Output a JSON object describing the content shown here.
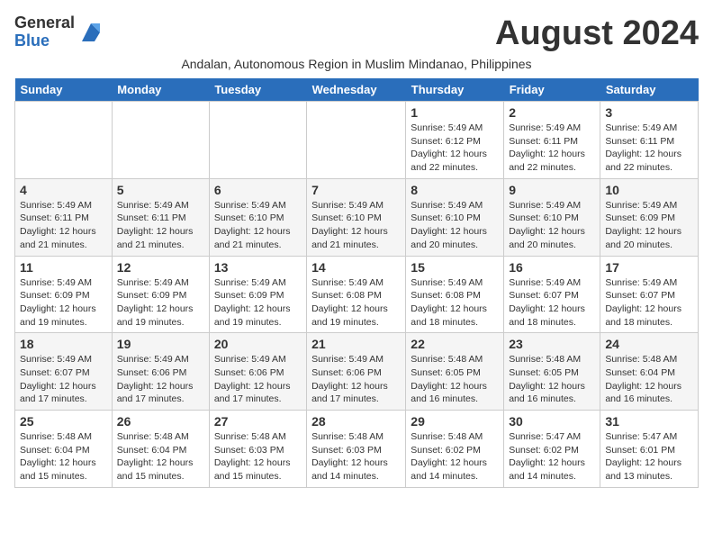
{
  "logo": {
    "general": "General",
    "blue": "Blue"
  },
  "title": "August 2024",
  "subtitle": "Andalan, Autonomous Region in Muslim Mindanao, Philippines",
  "headers": [
    "Sunday",
    "Monday",
    "Tuesday",
    "Wednesday",
    "Thursday",
    "Friday",
    "Saturday"
  ],
  "weeks": [
    [
      {
        "day": "",
        "sunrise": "",
        "sunset": "",
        "daylight": ""
      },
      {
        "day": "",
        "sunrise": "",
        "sunset": "",
        "daylight": ""
      },
      {
        "day": "",
        "sunrise": "",
        "sunset": "",
        "daylight": ""
      },
      {
        "day": "",
        "sunrise": "",
        "sunset": "",
        "daylight": ""
      },
      {
        "day": "1",
        "sunrise": "Sunrise: 5:49 AM",
        "sunset": "Sunset: 6:12 PM",
        "daylight": "Daylight: 12 hours and 22 minutes."
      },
      {
        "day": "2",
        "sunrise": "Sunrise: 5:49 AM",
        "sunset": "Sunset: 6:11 PM",
        "daylight": "Daylight: 12 hours and 22 minutes."
      },
      {
        "day": "3",
        "sunrise": "Sunrise: 5:49 AM",
        "sunset": "Sunset: 6:11 PM",
        "daylight": "Daylight: 12 hours and 22 minutes."
      }
    ],
    [
      {
        "day": "4",
        "sunrise": "Sunrise: 5:49 AM",
        "sunset": "Sunset: 6:11 PM",
        "daylight": "Daylight: 12 hours and 21 minutes."
      },
      {
        "day": "5",
        "sunrise": "Sunrise: 5:49 AM",
        "sunset": "Sunset: 6:11 PM",
        "daylight": "Daylight: 12 hours and 21 minutes."
      },
      {
        "day": "6",
        "sunrise": "Sunrise: 5:49 AM",
        "sunset": "Sunset: 6:10 PM",
        "daylight": "Daylight: 12 hours and 21 minutes."
      },
      {
        "day": "7",
        "sunrise": "Sunrise: 5:49 AM",
        "sunset": "Sunset: 6:10 PM",
        "daylight": "Daylight: 12 hours and 21 minutes."
      },
      {
        "day": "8",
        "sunrise": "Sunrise: 5:49 AM",
        "sunset": "Sunset: 6:10 PM",
        "daylight": "Daylight: 12 hours and 20 minutes."
      },
      {
        "day": "9",
        "sunrise": "Sunrise: 5:49 AM",
        "sunset": "Sunset: 6:10 PM",
        "daylight": "Daylight: 12 hours and 20 minutes."
      },
      {
        "day": "10",
        "sunrise": "Sunrise: 5:49 AM",
        "sunset": "Sunset: 6:09 PM",
        "daylight": "Daylight: 12 hours and 20 minutes."
      }
    ],
    [
      {
        "day": "11",
        "sunrise": "Sunrise: 5:49 AM",
        "sunset": "Sunset: 6:09 PM",
        "daylight": "Daylight: 12 hours and 19 minutes."
      },
      {
        "day": "12",
        "sunrise": "Sunrise: 5:49 AM",
        "sunset": "Sunset: 6:09 PM",
        "daylight": "Daylight: 12 hours and 19 minutes."
      },
      {
        "day": "13",
        "sunrise": "Sunrise: 5:49 AM",
        "sunset": "Sunset: 6:09 PM",
        "daylight": "Daylight: 12 hours and 19 minutes."
      },
      {
        "day": "14",
        "sunrise": "Sunrise: 5:49 AM",
        "sunset": "Sunset: 6:08 PM",
        "daylight": "Daylight: 12 hours and 19 minutes."
      },
      {
        "day": "15",
        "sunrise": "Sunrise: 5:49 AM",
        "sunset": "Sunset: 6:08 PM",
        "daylight": "Daylight: 12 hours and 18 minutes."
      },
      {
        "day": "16",
        "sunrise": "Sunrise: 5:49 AM",
        "sunset": "Sunset: 6:07 PM",
        "daylight": "Daylight: 12 hours and 18 minutes."
      },
      {
        "day": "17",
        "sunrise": "Sunrise: 5:49 AM",
        "sunset": "Sunset: 6:07 PM",
        "daylight": "Daylight: 12 hours and 18 minutes."
      }
    ],
    [
      {
        "day": "18",
        "sunrise": "Sunrise: 5:49 AM",
        "sunset": "Sunset: 6:07 PM",
        "daylight": "Daylight: 12 hours and 17 minutes."
      },
      {
        "day": "19",
        "sunrise": "Sunrise: 5:49 AM",
        "sunset": "Sunset: 6:06 PM",
        "daylight": "Daylight: 12 hours and 17 minutes."
      },
      {
        "day": "20",
        "sunrise": "Sunrise: 5:49 AM",
        "sunset": "Sunset: 6:06 PM",
        "daylight": "Daylight: 12 hours and 17 minutes."
      },
      {
        "day": "21",
        "sunrise": "Sunrise: 5:49 AM",
        "sunset": "Sunset: 6:06 PM",
        "daylight": "Daylight: 12 hours and 17 minutes."
      },
      {
        "day": "22",
        "sunrise": "Sunrise: 5:48 AM",
        "sunset": "Sunset: 6:05 PM",
        "daylight": "Daylight: 12 hours and 16 minutes."
      },
      {
        "day": "23",
        "sunrise": "Sunrise: 5:48 AM",
        "sunset": "Sunset: 6:05 PM",
        "daylight": "Daylight: 12 hours and 16 minutes."
      },
      {
        "day": "24",
        "sunrise": "Sunrise: 5:48 AM",
        "sunset": "Sunset: 6:04 PM",
        "daylight": "Daylight: 12 hours and 16 minutes."
      }
    ],
    [
      {
        "day": "25",
        "sunrise": "Sunrise: 5:48 AM",
        "sunset": "Sunset: 6:04 PM",
        "daylight": "Daylight: 12 hours and 15 minutes."
      },
      {
        "day": "26",
        "sunrise": "Sunrise: 5:48 AM",
        "sunset": "Sunset: 6:04 PM",
        "daylight": "Daylight: 12 hours and 15 minutes."
      },
      {
        "day": "27",
        "sunrise": "Sunrise: 5:48 AM",
        "sunset": "Sunset: 6:03 PM",
        "daylight": "Daylight: 12 hours and 15 minutes."
      },
      {
        "day": "28",
        "sunrise": "Sunrise: 5:48 AM",
        "sunset": "Sunset: 6:03 PM",
        "daylight": "Daylight: 12 hours and 14 minutes."
      },
      {
        "day": "29",
        "sunrise": "Sunrise: 5:48 AM",
        "sunset": "Sunset: 6:02 PM",
        "daylight": "Daylight: 12 hours and 14 minutes."
      },
      {
        "day": "30",
        "sunrise": "Sunrise: 5:47 AM",
        "sunset": "Sunset: 6:02 PM",
        "daylight": "Daylight: 12 hours and 14 minutes."
      },
      {
        "day": "31",
        "sunrise": "Sunrise: 5:47 AM",
        "sunset": "Sunset: 6:01 PM",
        "daylight": "Daylight: 12 hours and 13 minutes."
      }
    ]
  ]
}
